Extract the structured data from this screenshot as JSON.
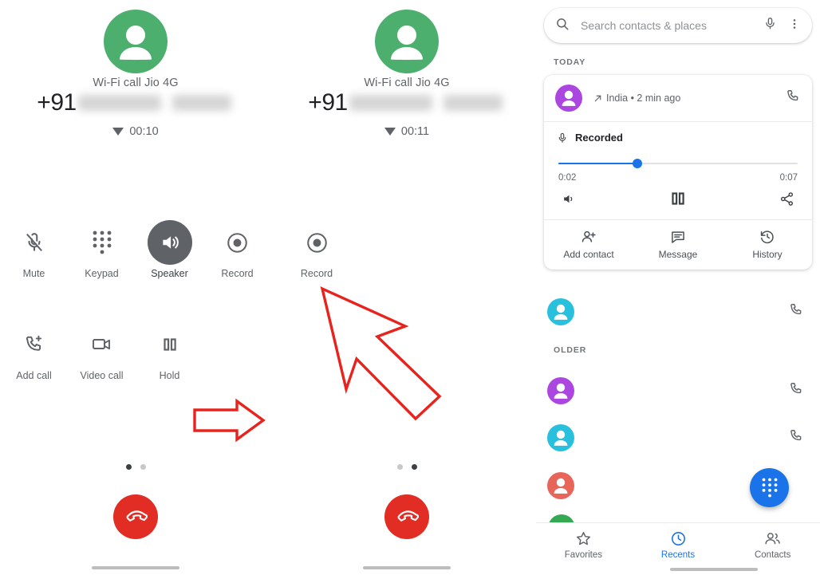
{
  "call_screens": [
    {
      "avatar_icon": "person-avatar-icon",
      "avatar_color": "#4caf6d",
      "carrier_status": "Wi-Fi call Jio 4G",
      "number_prefix": "+91",
      "number_redacted": true,
      "network_icon": "wifi-calling-triangle-icon",
      "duration": "00:10",
      "page_dots": {
        "count": 2,
        "active_index": 0
      },
      "end_call_icon": "end-call-icon",
      "end_call_color": "#e12d23",
      "actions": [
        {
          "id": "mute",
          "label": "Mute",
          "icon": "mic-off-icon",
          "active": false
        },
        {
          "id": "keypad",
          "label": "Keypad",
          "icon": "dialpad-icon",
          "active": false
        },
        {
          "id": "speaker",
          "label": "Speaker",
          "icon": "speaker-icon",
          "active": true
        },
        {
          "id": "record",
          "label": "Record",
          "icon": "record-dot-icon",
          "active": false
        },
        {
          "id": "add-call",
          "label": "Add call",
          "icon": "add-call-icon",
          "active": false
        },
        {
          "id": "video-call",
          "label": "Video call",
          "icon": "video-call-icon",
          "active": false
        },
        {
          "id": "hold",
          "label": "Hold",
          "icon": "pause-icon",
          "active": false
        }
      ]
    },
    {
      "avatar_icon": "person-avatar-icon",
      "avatar_color": "#4caf6d",
      "carrier_status": "Wi-Fi call Jio 4G",
      "number_prefix": "+91",
      "number_redacted": true,
      "network_icon": "wifi-calling-triangle-icon",
      "duration": "00:11",
      "page_dots": {
        "count": 2,
        "active_index": 1
      },
      "end_call_icon": "end-call-icon",
      "end_call_color": "#e12d23",
      "actions": [
        {
          "id": "record",
          "label": "Record",
          "icon": "record-dot-icon",
          "active": false
        }
      ]
    }
  ],
  "annotations": [
    {
      "id": "right-arrow",
      "shape": "block-arrow-right",
      "color": "#e8231d"
    },
    {
      "id": "record-pointer",
      "shape": "cursor-arrow-up-left",
      "color": "#e8231d"
    }
  ],
  "dialer": {
    "search": {
      "placeholder": "Search contacts & places",
      "search_icon": "search-icon",
      "mic_icon": "microphone-icon",
      "overflow_icon": "more-vert-icon"
    },
    "sections": [
      {
        "id": "today",
        "label": "TODAY"
      },
      {
        "id": "older",
        "label": "OLDER"
      }
    ],
    "expanded_call": {
      "avatar_color": "#ab47e0",
      "avatar_icon": "person-avatar-icon",
      "name_redacted": true,
      "direction_icon": "outgoing-call-arrow-icon",
      "detail": "India • 2 min ago",
      "call_back_icon": "phone-icon",
      "recording": {
        "badge_icon": "microphone-icon",
        "badge_label": "Recorded",
        "elapsed": "0:02",
        "total": "0:07",
        "progress_percent": 33,
        "accent_color": "#1a73e8",
        "volume_icon": "volume-icon",
        "playback_icon": "pause-icon",
        "share_icon": "share-icon"
      },
      "actions": [
        {
          "id": "add-contact",
          "label": "Add contact",
          "icon": "person-add-icon"
        },
        {
          "id": "message",
          "label": "Message",
          "icon": "message-icon"
        },
        {
          "id": "history",
          "label": "History",
          "icon": "history-icon"
        }
      ]
    },
    "rows": [
      {
        "id": "row-a",
        "avatar_color": "#29c0de",
        "line2_pink": false,
        "l1_width": 96,
        "l2_width": 122,
        "call_icon": "phone-icon"
      },
      {
        "id": "row-b",
        "avatar_color": "#ab47e0",
        "line2_pink": false,
        "l1_width": 108,
        "l2_width": 40,
        "call_icon": "phone-icon"
      },
      {
        "id": "row-c",
        "avatar_color": "#29c0de",
        "line2_pink": true,
        "l1_width": 132,
        "l2_width": 78,
        "call_icon": "phone-icon"
      },
      {
        "id": "row-d",
        "avatar_color": "#e8655a",
        "line2_pink": false,
        "l1_width": 66,
        "l2_width": 48,
        "call_icon": null
      }
    ],
    "partial_row_avatar_color": "#34a853",
    "fab": {
      "icon": "dialpad-icon",
      "color": "#1a73e8"
    },
    "bottom_nav": [
      {
        "id": "favorites",
        "label": "Favorites",
        "icon": "star-icon",
        "selected": false
      },
      {
        "id": "recents",
        "label": "Recents",
        "icon": "clock-icon",
        "selected": true
      },
      {
        "id": "contacts",
        "label": "Contacts",
        "icon": "people-icon",
        "selected": false
      }
    ]
  }
}
